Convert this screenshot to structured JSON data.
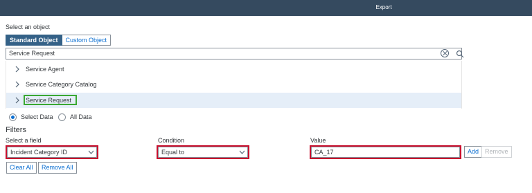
{
  "topbar": {
    "title": "Export"
  },
  "object": {
    "label": "Select an object",
    "tabs": [
      {
        "label": "Standard Object",
        "selected": true
      },
      {
        "label": "Custom Object",
        "selected": false
      }
    ]
  },
  "search": {
    "value": "Service Request"
  },
  "results": [
    {
      "label": "Service Agent"
    },
    {
      "label": "Service Category Catalog"
    },
    {
      "label": "Service Request"
    }
  ],
  "data_mode": {
    "options": [
      {
        "label": "Select Data",
        "selected": true
      },
      {
        "label": "All Data",
        "selected": false
      }
    ]
  },
  "filters": {
    "heading": "Filters",
    "field_label": "Select a field",
    "field_value": "Incident Category ID",
    "condition_label": "Condition",
    "condition_value": "Equal to",
    "value_label": "Value",
    "value_value": "CA_17",
    "add_label": "Add",
    "remove_label": "Remove",
    "clear_all_label": "Clear All",
    "remove_all_label": "Remove All"
  },
  "colors": {
    "topbar": "#354a5f",
    "accent": "#0a6ed1",
    "highlight_green": "#3aa832",
    "highlight_red": "#c8102e"
  }
}
